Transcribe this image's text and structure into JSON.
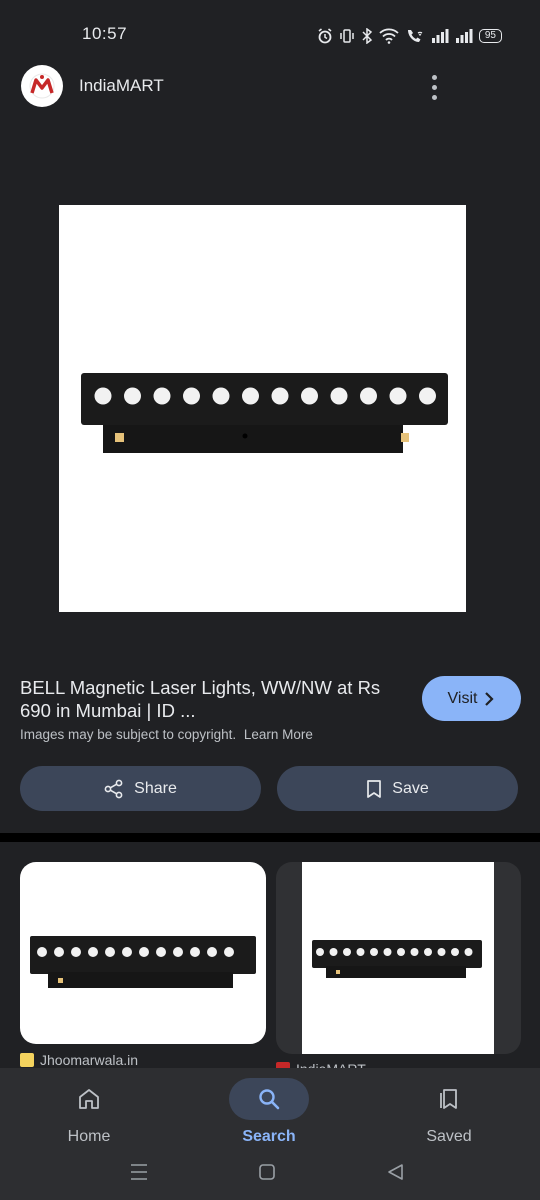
{
  "status_bar": {
    "time": "10:57",
    "battery": "95"
  },
  "header": {
    "source_name": "IndiaMART"
  },
  "result": {
    "title": "BELL Magnetic Laser Lights, WW/NW at Rs 690 in Mumbai | ID ...",
    "copyright": "Images may be subject to copyright.",
    "learn_more": "Learn More",
    "visit_label": "Visit",
    "share_label": "Share",
    "save_label": "Save"
  },
  "related": [
    {
      "source": "Jhoomarwala.in"
    },
    {
      "source": "IndiaMART"
    }
  ],
  "bottom_nav": [
    {
      "label": "Home",
      "icon": "home-icon"
    },
    {
      "label": "Search",
      "icon": "search-icon",
      "active": true
    },
    {
      "label": "Saved",
      "icon": "saved-icon"
    }
  ],
  "colors": {
    "accent": "#8ab4f8",
    "background": "#202124",
    "pill": "#3c4659"
  }
}
